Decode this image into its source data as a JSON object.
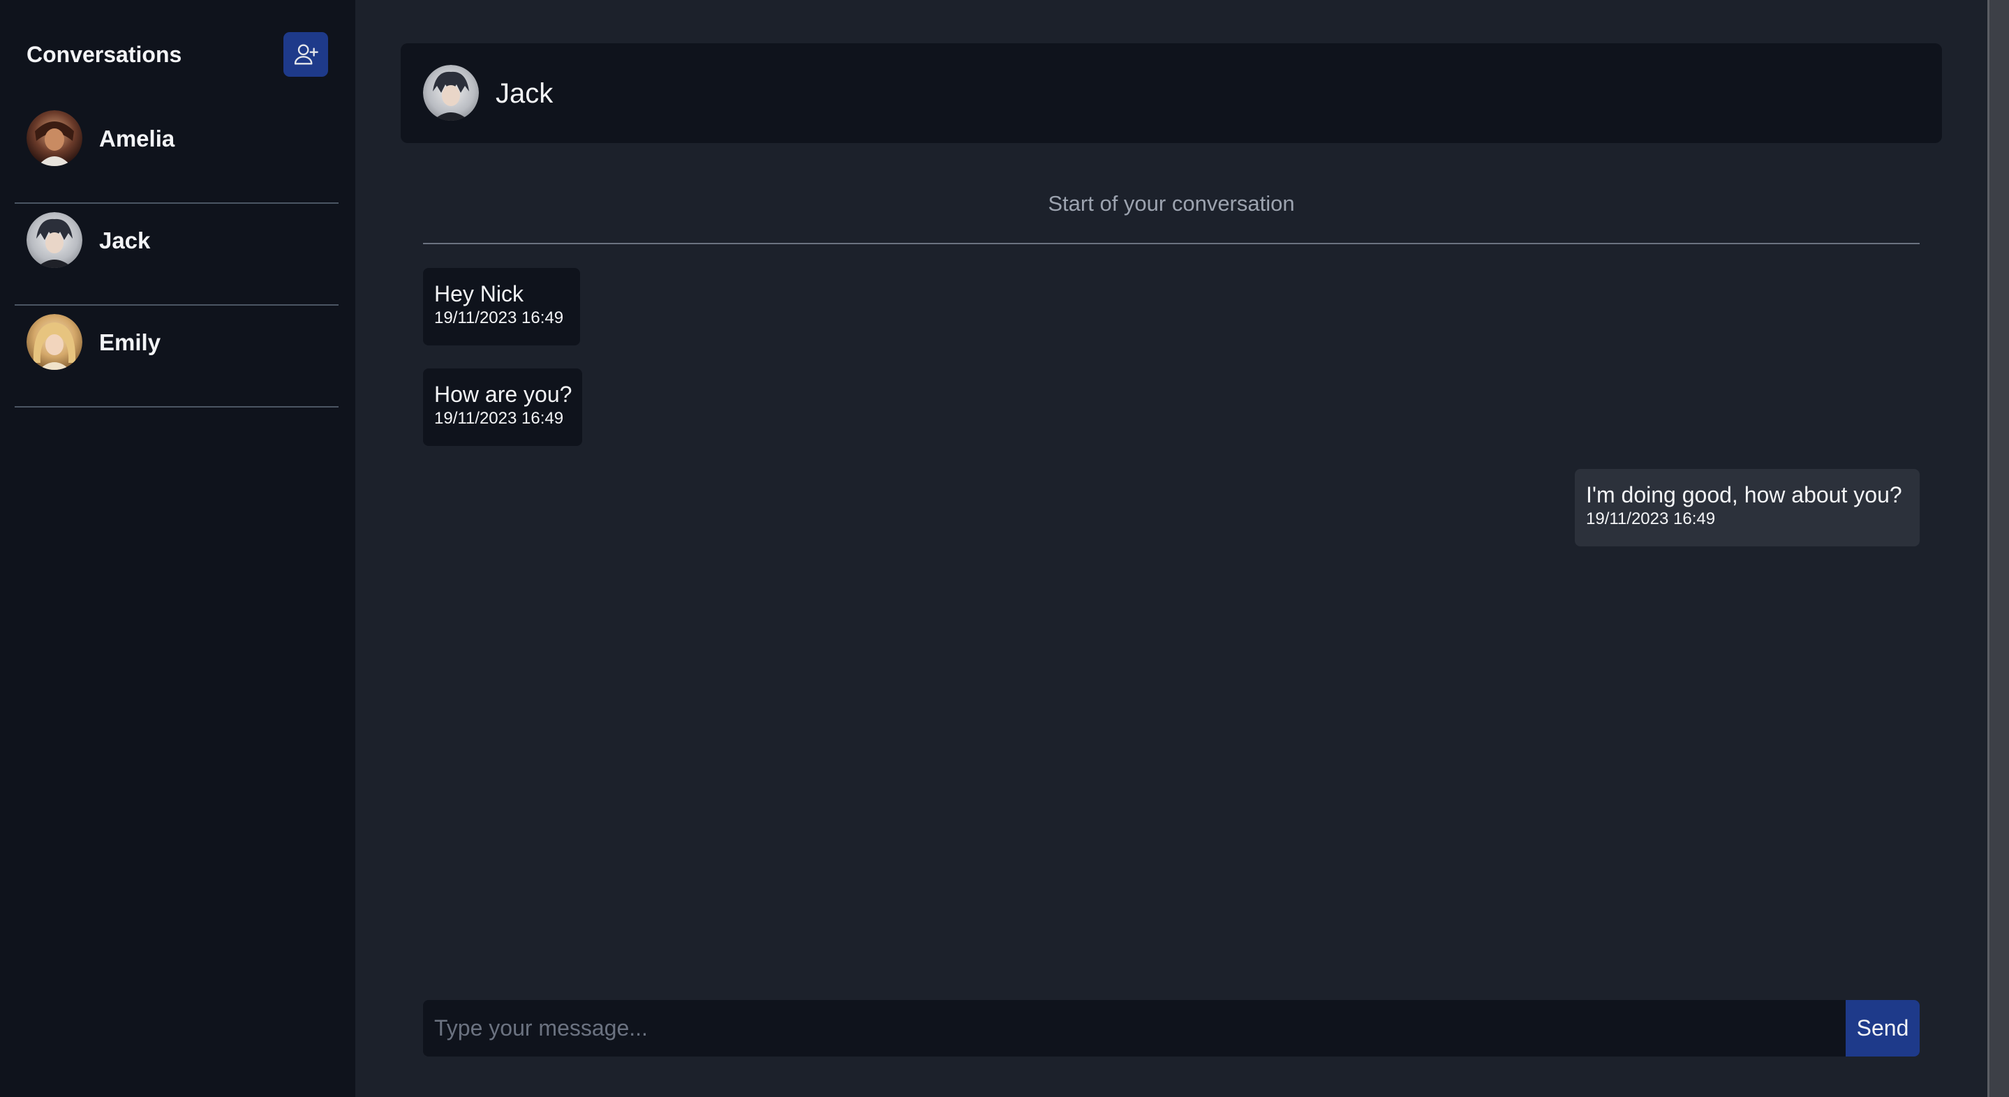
{
  "sidebar": {
    "title": "Conversations",
    "add_button_icon": "user-plus-icon",
    "conversations": [
      {
        "name": "Amelia",
        "avatar": "amelia-avatar"
      },
      {
        "name": "Jack",
        "avatar": "jack-avatar"
      },
      {
        "name": "Emily",
        "avatar": "emily-avatar"
      }
    ]
  },
  "chat": {
    "contact_name": "Jack",
    "start_text": "Start of your conversation",
    "messages": [
      {
        "text": "Hey Nick",
        "time": "19/11/2023 16:49",
        "direction": "incoming"
      },
      {
        "text": "How are you?",
        "time": "19/11/2023 16:49",
        "direction": "incoming"
      },
      {
        "text": "I'm doing good, how about you?",
        "time": "19/11/2023 16:49",
        "direction": "outgoing"
      }
    ],
    "composer": {
      "placeholder": "Type your message...",
      "value": "",
      "send_label": "Send"
    }
  },
  "colors": {
    "sidebar_bg": "#0f131c",
    "main_bg": "#1c212b",
    "accent": "#1e3a8a",
    "outgoing_bubble": "#2c313b",
    "muted_text": "#9ca3af"
  }
}
